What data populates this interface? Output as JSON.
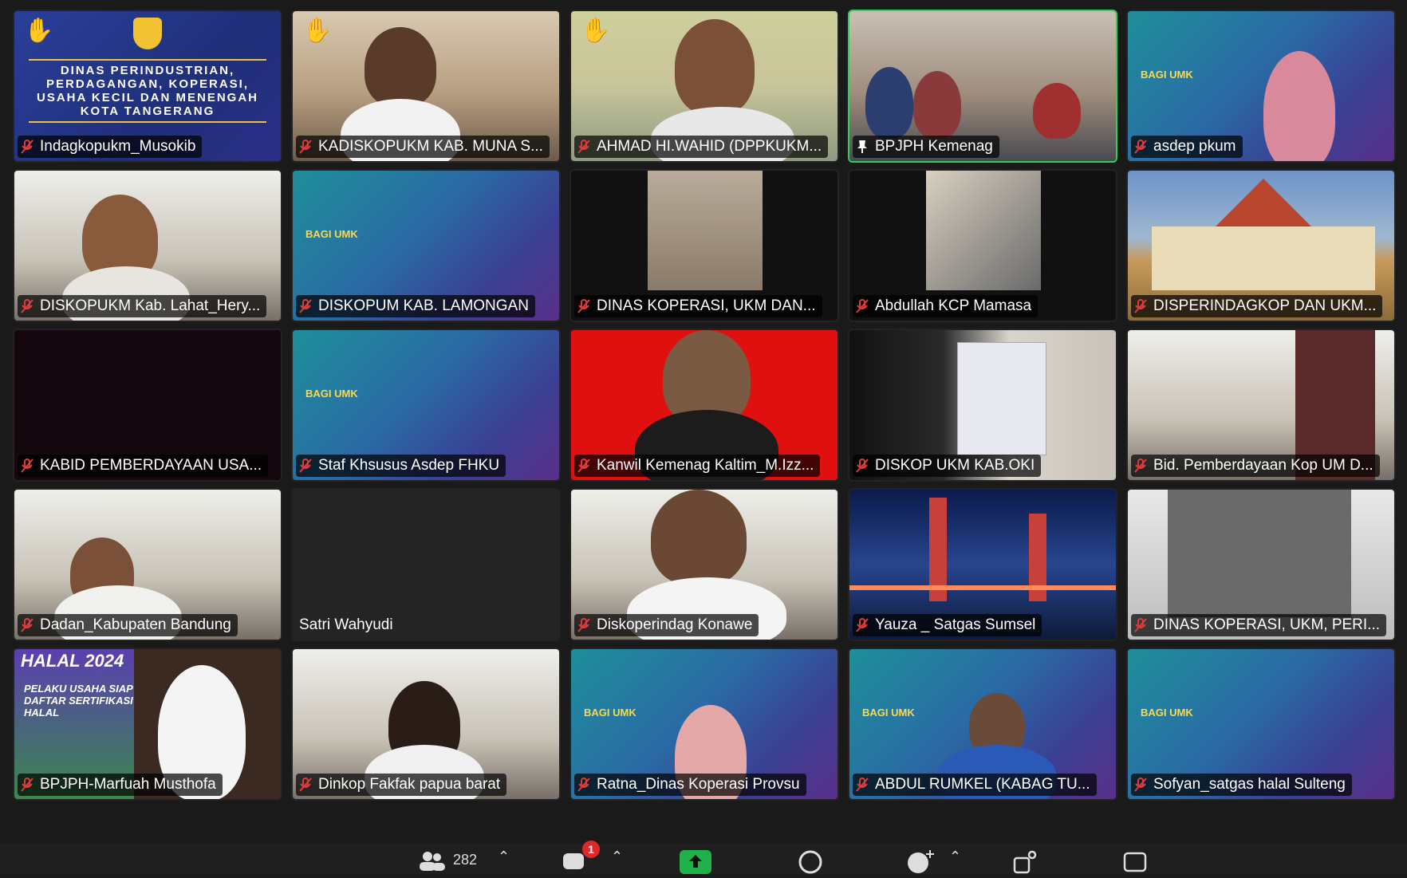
{
  "participants": [
    {
      "name": "Indagkopukm_Musokib",
      "muted": true,
      "hand": true
    },
    {
      "name": "KADISKOPUKM KAB. MUNA S...",
      "muted": true,
      "hand": true
    },
    {
      "name": "AHMAD HI.WAHID (DPPKUKM...",
      "muted": true,
      "hand": true
    },
    {
      "name": "BPJPH Kemenag",
      "muted": false,
      "pinned": true,
      "active": true
    },
    {
      "name": "asdep pkum",
      "muted": true
    },
    {
      "name": "DISKOPUKM Kab. Lahat_Hery...",
      "muted": true
    },
    {
      "name": "DISKOPUM KAB. LAMONGAN",
      "muted": true
    },
    {
      "name": "DINAS KOPERASI, UKM DAN...",
      "muted": true
    },
    {
      "name": "Abdullah KCP Mamasa",
      "muted": true
    },
    {
      "name": "DISPERINDAGKOP DAN UKM...",
      "muted": true
    },
    {
      "name": "KABID PEMBERDAYAAN USA...",
      "muted": true
    },
    {
      "name": "Staf Khsusus Asdep FHKU",
      "muted": true
    },
    {
      "name": "Kanwil Kemenag Kaltim_M.Izz...",
      "muted": true
    },
    {
      "name": "DISKOP UKM  KAB.OKI",
      "muted": true
    },
    {
      "name": "Bid. Pemberdayaan Kop UM D...",
      "muted": true
    },
    {
      "name": "Dadan_Kabupaten Bandung",
      "muted": true
    },
    {
      "name": "Satri Wahyudi",
      "muted": false
    },
    {
      "name": "Diskoperindag Konawe",
      "muted": true
    },
    {
      "name": "Yauza _ Satgas Sumsel",
      "muted": true
    },
    {
      "name": "DINAS KOPERASI, UKM, PERI...",
      "muted": true
    },
    {
      "name": "BPJPH-Marfuah Musthofa",
      "muted": true
    },
    {
      "name": "Dinkop Fakfak papua barat",
      "muted": true
    },
    {
      "name": "Ratna_Dinas Koperasi Provsu",
      "muted": true
    },
    {
      "name": "ABDUL RUMKEL (KABAG TU...",
      "muted": true
    },
    {
      "name": "Sofyan_satgas halal Sulteng",
      "muted": true
    }
  ],
  "tile_texts": {
    "dinas": "DINAS PERINDUSTRIAN, PERDAGANGAN, KOPERASI, USAHA KECIL DAN MENENGAH KOTA TANGERANG",
    "bagi_umk": "BAGI UMK",
    "halal_year": "HALAL 2024",
    "halal_text": "PELAKU USAHA SIAP DAFTAR SERTIFIKASI HALAL"
  },
  "toolbar": {
    "participants_count": "282",
    "chat_badge": "1"
  },
  "colors": {
    "active_border": "#2fd15a",
    "muted_red": "#e03a3a",
    "share_green": "#1fb24a"
  }
}
